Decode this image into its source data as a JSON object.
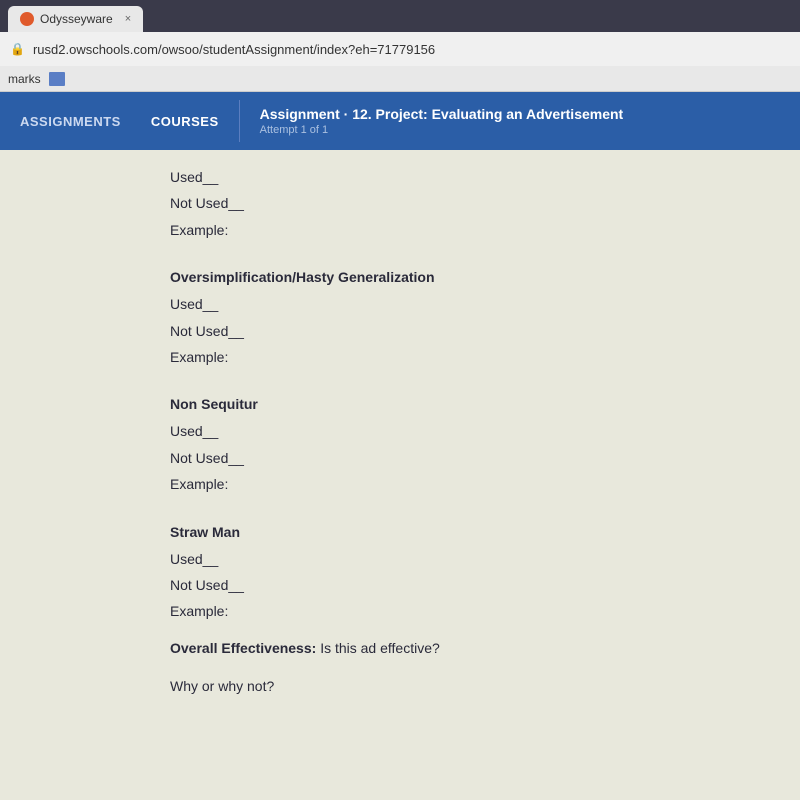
{
  "browser": {
    "tab_title": "Odysseyware",
    "tab_close": "×",
    "address": "rusd2.owschools.com/owsoo/studentAssignment/index?eh=71779156",
    "lock_symbol": "🔒"
  },
  "bookmarks": {
    "label": "marks"
  },
  "nav": {
    "assignments_label": "ASSIGNMENTS",
    "courses_label": "COURSES",
    "assignment_prefix": "Assignment",
    "assignment_number": "· 12. Project: Evaluating an Advertisement",
    "attempt_label": "Attempt 1 of 1"
  },
  "content": {
    "used_partial": "Used__",
    "not_used_1": "Not Used__",
    "example_1": "Example:",
    "section1_heading": "Oversimplification/Hasty Generalization",
    "section1_used": "Used__",
    "section1_not_used": "Not Used__",
    "section1_example": "Example:",
    "section2_heading": "Non Sequitur",
    "section2_used": "Used__",
    "section2_not_used": "Not Used__",
    "section2_example": "Example:",
    "section3_heading": "Straw Man",
    "section3_used": "Used__",
    "section3_not_used": "Not Used__",
    "section3_example": "Example:",
    "overall_label": "Overall Effectiveness:",
    "overall_text": " Is this ad effective?",
    "why_label": "Why or why not?"
  }
}
